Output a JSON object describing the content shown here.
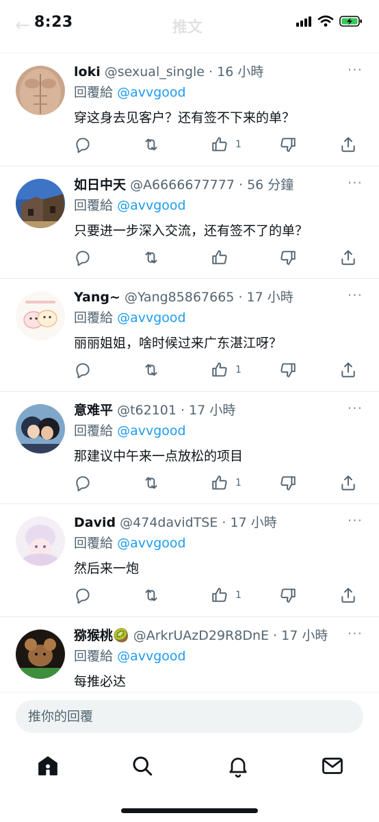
{
  "status_bar": {
    "time": "8:23"
  },
  "header": {
    "back_icon": "back-arrow-icon",
    "title": "推文"
  },
  "replies": [
    {
      "name": "loki",
      "handle": "@sexual_single",
      "time": "16 小時",
      "reply_label": "回覆給",
      "reply_to": "@avvgood",
      "text": "穿这身去见客户？还有签不下来的单？",
      "likes": "1"
    },
    {
      "name": "如日中天",
      "handle": "@A6666677777",
      "time": "56 分鐘",
      "reply_label": "回覆給",
      "reply_to": "@avvgood",
      "text": "只要进一步深入交流，还有签不了的单？",
      "likes": ""
    },
    {
      "name": "Yang~",
      "handle": "@Yang85867665",
      "time": "17 小時",
      "reply_label": "回覆給",
      "reply_to": "@avvgood",
      "text": "丽丽姐姐，啥时候过来广东湛江呀？",
      "likes": "1"
    },
    {
      "name": "意难平",
      "handle": "@t62101",
      "time": "17 小時",
      "reply_label": "回覆給",
      "reply_to": "@avvgood",
      "text": "那建议中午来一点放松的项目",
      "likes": "1"
    },
    {
      "name": "David",
      "handle": "@474davidTSE",
      "time": "17 小時",
      "reply_label": "回覆給",
      "reply_to": "@avvgood",
      "text": "然后来一炮",
      "likes": "1"
    },
    {
      "name": "猕猴桃🥝",
      "handle": "@ArkrUAzD29R8DnE",
      "time": "17 小時",
      "reply_label": "回覆給",
      "reply_to": "@avvgood",
      "text": "每推必达",
      "likes": ""
    }
  ],
  "separator": "·",
  "more_glyph": "···",
  "compose": {
    "placeholder": "推你的回覆"
  },
  "tabbar": {
    "items": [
      "home-icon",
      "search-icon",
      "bell-icon",
      "mail-icon"
    ]
  },
  "colors": {
    "accent": "#1d9bf0",
    "secondary_text": "#536471",
    "divider": "#eff3f4"
  }
}
